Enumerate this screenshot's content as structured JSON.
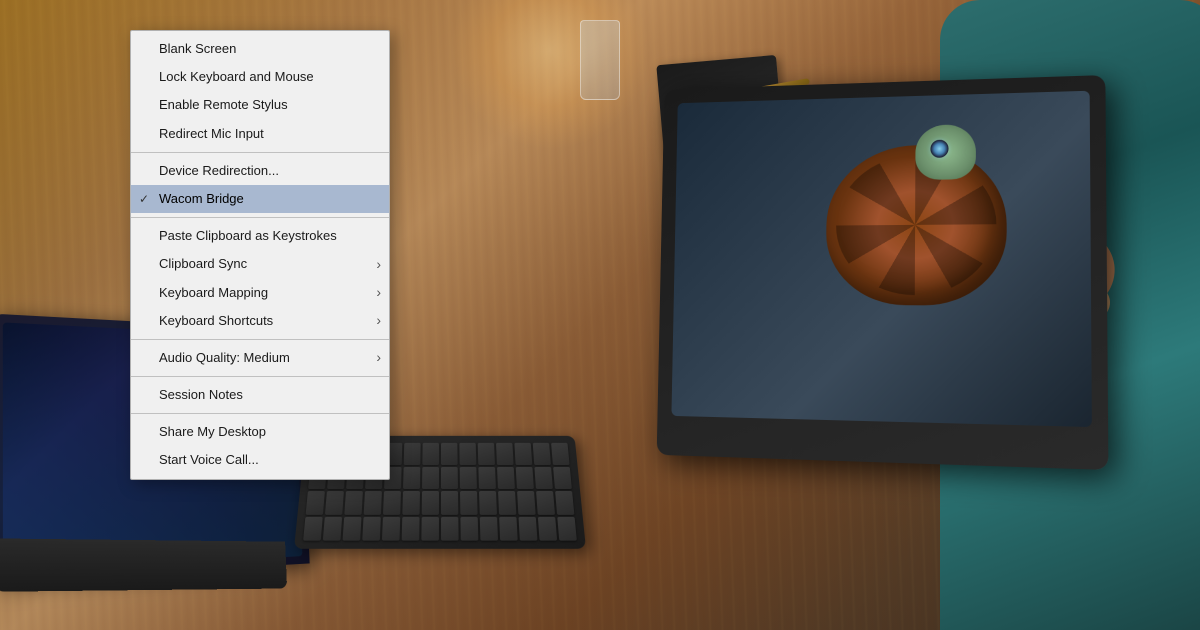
{
  "background": {
    "color": "#8B6914"
  },
  "menu": {
    "items": [
      {
        "id": "blank-screen",
        "label": "Blank Screen",
        "hasSeparator": false,
        "hasSubmenu": false,
        "checked": false,
        "highlighted": false
      },
      {
        "id": "lock-keyboard",
        "label": "Lock Keyboard and Mouse",
        "hasSeparator": false,
        "hasSubmenu": false,
        "checked": false,
        "highlighted": false
      },
      {
        "id": "enable-stylus",
        "label": "Enable Remote Stylus",
        "hasSeparator": false,
        "hasSubmenu": false,
        "checked": false,
        "highlighted": false
      },
      {
        "id": "redirect-mic",
        "label": "Redirect Mic Input",
        "hasSeparator": false,
        "hasSubmenu": false,
        "checked": false,
        "highlighted": false
      },
      {
        "id": "separator1",
        "label": "",
        "hasSeparator": true,
        "hasSubmenu": false,
        "checked": false,
        "highlighted": false
      },
      {
        "id": "device-redirection",
        "label": "Device Redirection...",
        "hasSeparator": false,
        "hasSubmenu": false,
        "checked": false,
        "highlighted": false
      },
      {
        "id": "wacom-bridge",
        "label": "Wacom Bridge",
        "hasSeparator": false,
        "hasSubmenu": false,
        "checked": true,
        "highlighted": true
      },
      {
        "id": "separator2",
        "label": "",
        "hasSeparator": true,
        "hasSubmenu": false,
        "checked": false,
        "highlighted": false
      },
      {
        "id": "paste-clipboard",
        "label": "Paste Clipboard as Keystrokes",
        "hasSeparator": false,
        "hasSubmenu": false,
        "checked": false,
        "highlighted": false
      },
      {
        "id": "clipboard-sync",
        "label": "Clipboard Sync",
        "hasSeparator": false,
        "hasSubmenu": true,
        "checked": false,
        "highlighted": false
      },
      {
        "id": "keyboard-mapping",
        "label": "Keyboard Mapping",
        "hasSeparator": false,
        "hasSubmenu": true,
        "checked": false,
        "highlighted": false
      },
      {
        "id": "keyboard-shortcuts",
        "label": "Keyboard Shortcuts",
        "hasSeparator": false,
        "hasSubmenu": true,
        "checked": false,
        "highlighted": false
      },
      {
        "id": "separator3",
        "label": "",
        "hasSeparator": true,
        "hasSubmenu": false,
        "checked": false,
        "highlighted": false
      },
      {
        "id": "audio-quality",
        "label": "Audio Quality: Medium",
        "hasSeparator": false,
        "hasSubmenu": true,
        "checked": false,
        "highlighted": false
      },
      {
        "id": "separator4",
        "label": "",
        "hasSeparator": true,
        "hasSubmenu": false,
        "checked": false,
        "highlighted": false
      },
      {
        "id": "session-notes",
        "label": "Session Notes",
        "hasSeparator": false,
        "hasSubmenu": false,
        "checked": false,
        "highlighted": false
      },
      {
        "id": "separator5",
        "label": "",
        "hasSeparator": true,
        "hasSubmenu": false,
        "checked": false,
        "highlighted": false
      },
      {
        "id": "share-desktop",
        "label": "Share My Desktop",
        "hasSeparator": false,
        "hasSubmenu": false,
        "checked": false,
        "highlighted": false
      },
      {
        "id": "start-voice",
        "label": "Start Voice Call...",
        "hasSeparator": false,
        "hasSubmenu": false,
        "checked": false,
        "highlighted": false
      }
    ]
  }
}
